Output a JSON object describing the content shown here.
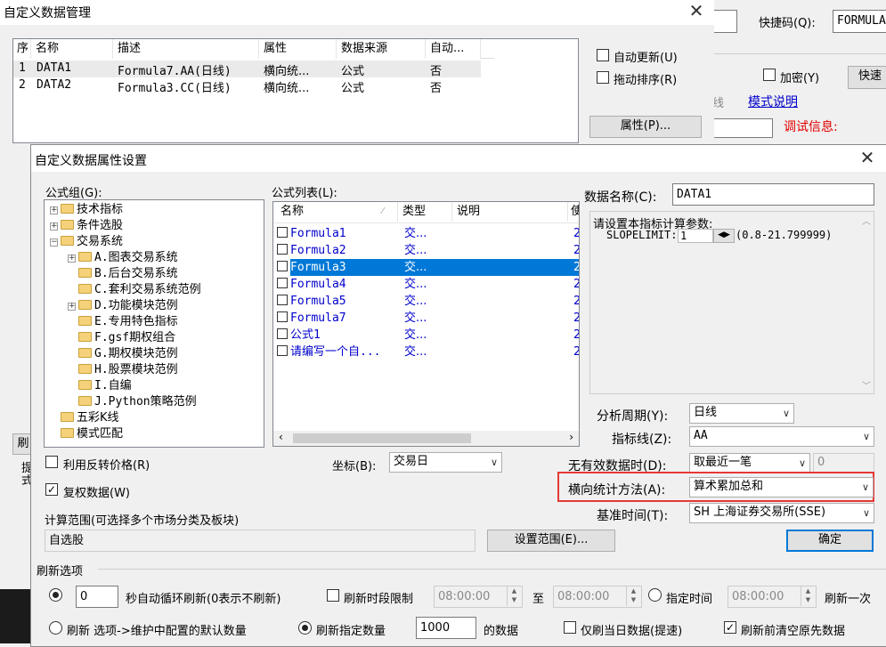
{
  "bg": {
    "shortcut_label": "快捷码(Q):",
    "shortcut_value": "FORMULA",
    "encrypt_label": "加密(Y)",
    "fast_button": "快速",
    "line_text": "线",
    "mode_desc": "模式说明",
    "debug_label": "调试信息:"
  },
  "mgr": {
    "title": "自定义数据管理",
    "columns": [
      "序",
      "名称",
      "描述",
      "属性",
      "数据来源",
      "自动..."
    ],
    "rows": [
      {
        "no": "1",
        "name": "DATA1",
        "desc": "Formula7.AA(日线)",
        "attr": "横向统...",
        "src": "公式",
        "auto": "否"
      },
      {
        "no": "2",
        "name": "DATA2",
        "desc": "Formula3.CC(日线)",
        "attr": "横向统...",
        "src": "公式",
        "auto": "否"
      }
    ],
    "auto_update": "自动更新(U)",
    "drag_sort": "拖动排序(R)",
    "attr_button": "属性(P)...",
    "left_btn_partial": "刷",
    "left_text_partial": "提\n式"
  },
  "dlg": {
    "title": "自定义数据属性设置",
    "formula_group_label": "公式组(G):",
    "tree": [
      {
        "label": "技术指标",
        "level": 0,
        "expander": "+"
      },
      {
        "label": "条件选股",
        "level": 0,
        "expander": "+"
      },
      {
        "label": "交易系统",
        "level": 0,
        "expander": "-"
      },
      {
        "label": "A.图表交易系统",
        "level": 1,
        "expander": "+"
      },
      {
        "label": "B.后台交易系统",
        "level": 1,
        "expander": ""
      },
      {
        "label": "C.套利交易系统范例",
        "level": 1,
        "expander": ""
      },
      {
        "label": "D.功能模块范例",
        "level": 1,
        "expander": "+"
      },
      {
        "label": "E.专用特色指标",
        "level": 1,
        "expander": ""
      },
      {
        "label": "F.gsf期权组合",
        "level": 1,
        "expander": ""
      },
      {
        "label": "G.期权模块范例",
        "level": 1,
        "expander": ""
      },
      {
        "label": "H.股票模块范例",
        "level": 1,
        "expander": ""
      },
      {
        "label": "I.自编",
        "level": 1,
        "expander": ""
      },
      {
        "label": "J.Python策略范例",
        "level": 1,
        "expander": ""
      },
      {
        "label": "五彩K线",
        "level": 0,
        "expander": ""
      },
      {
        "label": "模式匹配",
        "level": 0,
        "expander": ""
      }
    ],
    "formula_list_label": "公式列表(L):",
    "list_columns": [
      "名称",
      "类型",
      "说明",
      "使"
    ],
    "formulas": [
      {
        "name": "Formula1",
        "type": "交...",
        "num": "2"
      },
      {
        "name": "Formula2",
        "type": "交...",
        "num": "2"
      },
      {
        "name": "Formula3",
        "type": "交...",
        "num": "2",
        "selected": true
      },
      {
        "name": "Formula4",
        "type": "交...",
        "num": "2"
      },
      {
        "name": "Formula5",
        "type": "交...",
        "num": "2"
      },
      {
        "name": "Formula7",
        "type": "交...",
        "num": "2"
      },
      {
        "name": "公式1",
        "type": "交...",
        "num": "2"
      },
      {
        "name": "请编写一个自...",
        "type": "交...",
        "num": "2"
      }
    ],
    "data_name_label": "数据名称(C):",
    "data_name_value": "DATA1",
    "param_title": "请设置本指标计算参数:",
    "param_name": "SLOPELIMIT:",
    "param_value": "1",
    "param_range": "(0.8-21.799999)",
    "period_label": "分析周期(Y):",
    "period_value": "日线",
    "indicator_label": "指标线(Z):",
    "indicator_value": "AA",
    "invert_label": "利用反转价格(R)",
    "coord_label": "坐标(B):",
    "coord_value": "交易日",
    "noval_label": "无有效数据时(D):",
    "noval_value": "取最近一笔",
    "noval_num": "0",
    "adjust_label": "复权数据(W)",
    "horiz_label": "横向统计方法(A):",
    "horiz_value": "算术累加总和",
    "range_label": "计算范围(可选择多个市场分类及板块)",
    "range_value": "自选股",
    "set_range_button": "设置范围(E)...",
    "base_time_label": "基准时间(T):",
    "base_time_value": "SH 上海证券交易所(SSE)",
    "ok_button": "确定",
    "refresh_options": "刷新选项",
    "loop_value": "0",
    "loop_label": "秒自动循环刷新(0表示不刷新)",
    "period_limit_label": "刷新时段限制",
    "time_from": "08:00:00",
    "to_label": "至",
    "time_to": "08:00:00",
    "spec_time_label": "指定时间",
    "spec_time_value": "08:00:00",
    "refresh_once": "刷新一次",
    "refresh_default_label": "刷新 选项->维护中配置的默认数量",
    "refresh_spec_label": "刷新指定数量",
    "refresh_count": "1000",
    "data_suffix": "的数据",
    "today_only_label": "仅刷当日数据(提速)",
    "clear_before_label": "刷新前清空原先数据"
  },
  "colors": {
    "highlight_box": "#e53935",
    "selection": "#0078d7",
    "link": "#0000cc",
    "accent": "#0078d7"
  }
}
